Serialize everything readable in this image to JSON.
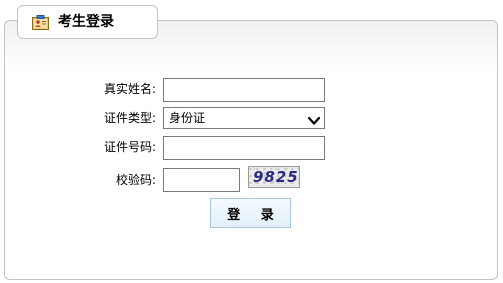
{
  "panel": {
    "title": "考生登录",
    "title_icon": "id-card-icon"
  },
  "form": {
    "name_label": "真实姓名:",
    "name_value": "",
    "id_type_label": "证件类型:",
    "id_type_selected": "身份证",
    "id_number_label": "证件号码:",
    "id_number_value": "",
    "captcha_label": "校验码:",
    "captcha_value": "",
    "captcha_image_text": "9825"
  },
  "actions": {
    "login_label": "登 录"
  },
  "colors": {
    "border": "#c4c4c4",
    "button_border": "#a9c7db",
    "button_bg": "#e2f0f9",
    "captcha_text": "#2b2b82"
  }
}
